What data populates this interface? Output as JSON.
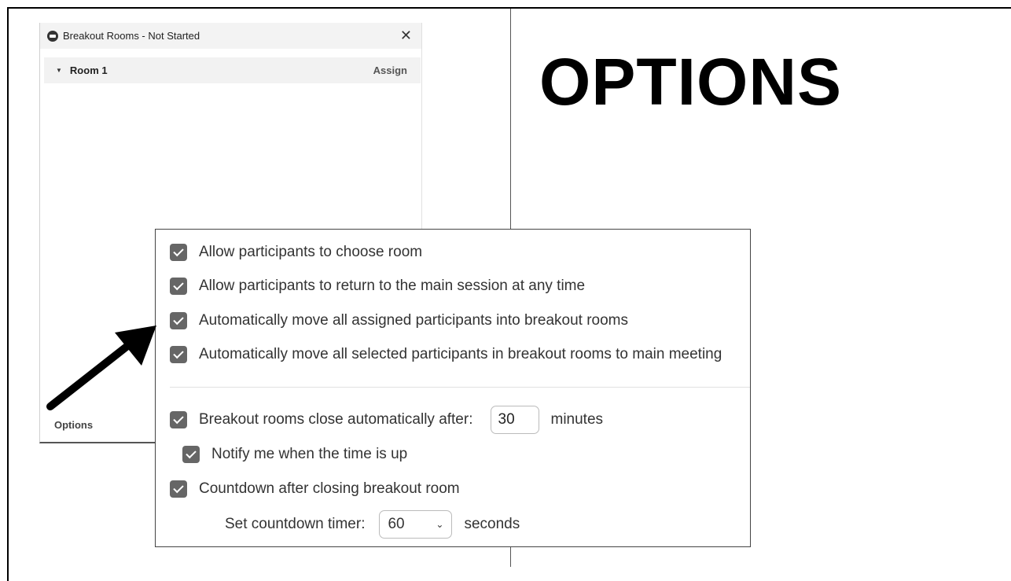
{
  "slide": {
    "title": "OPTIONS"
  },
  "breakout_window": {
    "title": "Breakout Rooms - Not Started",
    "close_glyph": "✕",
    "room": {
      "caret": "▼",
      "name": "Room 1",
      "assign_label": "Assign"
    },
    "options_label": "Options"
  },
  "options_panel": {
    "checkboxes": [
      {
        "label": "Allow participants to choose room",
        "checked": true
      },
      {
        "label": "Allow participants to return to the main session at any time",
        "checked": true
      },
      {
        "label": "Automatically move all assigned participants into breakout rooms",
        "checked": true
      },
      {
        "label": "Automatically move all selected participants in breakout rooms to main meeting",
        "checked": true
      }
    ],
    "auto_close": {
      "label": "Breakout rooms close automatically after:",
      "value": "30",
      "unit": "minutes",
      "checked": true
    },
    "notify": {
      "label": "Notify me when the time is up",
      "checked": true
    },
    "countdown": {
      "label": "Countdown after closing breakout room",
      "checked": true
    },
    "countdown_timer": {
      "label": "Set countdown timer:",
      "value": "60",
      "unit": "seconds",
      "chevron": "⌄"
    }
  },
  "icons": {
    "app": "zoom-app-icon",
    "close": "close-icon",
    "caret": "caret-down-icon",
    "check": "checkmark-icon",
    "chevron": "chevron-down-icon",
    "arrow": "pointer-arrow-icon"
  },
  "colors": {
    "checkbox": "#666666",
    "arrow": "#000000",
    "title": "#000000"
  }
}
